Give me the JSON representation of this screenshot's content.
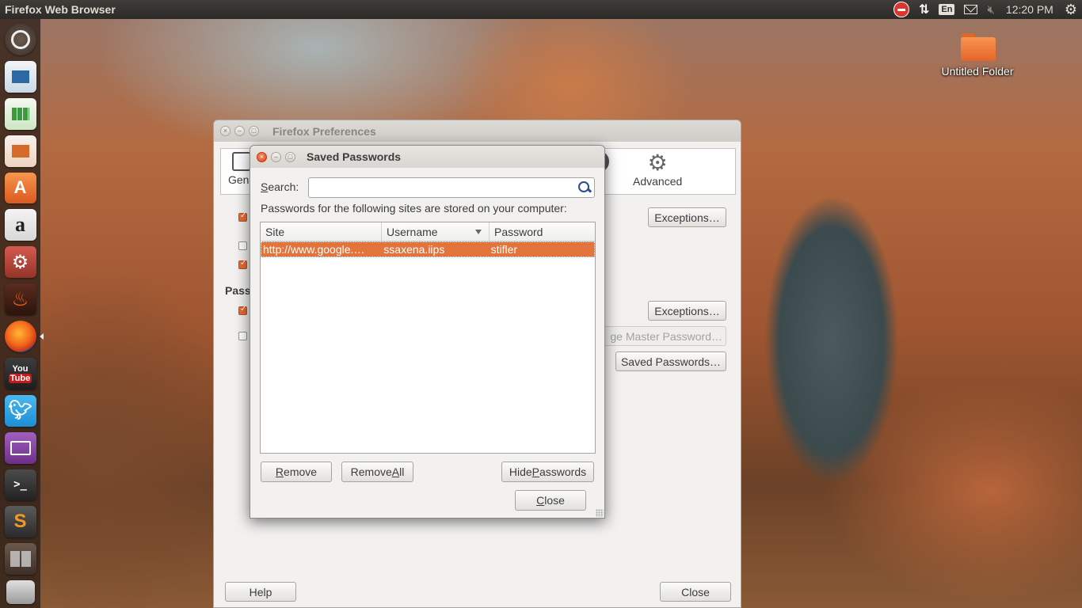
{
  "top_panel": {
    "app_title": "Firefox Web Browser",
    "keyboard_layout": "En",
    "clock": "12:20 PM"
  },
  "launcher": {
    "items": [
      "dash-icon",
      "libreoffice-writer-icon",
      "libreoffice-calc-icon",
      "libreoffice-impress-icon",
      "ubuntu-software-center-icon",
      "amazon-icon",
      "system-settings-icon",
      "fire-app-icon",
      "firefox-icon",
      "youtube-icon",
      "twitter-icon",
      "purple-app-icon",
      "terminal-icon",
      "sublime-text-icon",
      "workspace-switcher-icon",
      "trash-stack-icon"
    ],
    "amazon_glyph": "a",
    "youtube_top": "You",
    "youtube_bottom": "Tube",
    "terminal_glyph": ">_",
    "sublime_glyph": "S",
    "software_glyph": "A"
  },
  "desktop": {
    "folder_label": "Untitled Folder"
  },
  "preferences": {
    "title": "Firefox Preferences",
    "toolbar": {
      "general_label": "Gene",
      "sync_label": "c",
      "advanced_label": "Advanced"
    },
    "section_passwords": "Pass",
    "exceptions_label_1": "Exceptions…",
    "exceptions_label_2": "Exceptions…",
    "change_master_password_label": "ge Master Password…",
    "saved_passwords_label": "Saved Passwords…",
    "help_label": "Help",
    "close_label": "Close"
  },
  "saved_passwords": {
    "title": "Saved Passwords",
    "search_label": "Search:",
    "search_value": "",
    "description": "Passwords for the following sites are stored on your computer:",
    "columns": [
      "Site",
      "Username",
      "Password"
    ],
    "rows": [
      {
        "site": "http://www.google.…",
        "username": "ssaxena.iips",
        "password": "stifler"
      }
    ],
    "remove_label": "Remove",
    "remove_all_label": "Remove All",
    "hide_passwords_label": "Hide Passwords",
    "close_label": "Close"
  },
  "colors": {
    "selection": "#e2743c",
    "panel": "#2c2b28",
    "window_bg": "#f2f1f0",
    "close_button": "#df4a1e"
  }
}
